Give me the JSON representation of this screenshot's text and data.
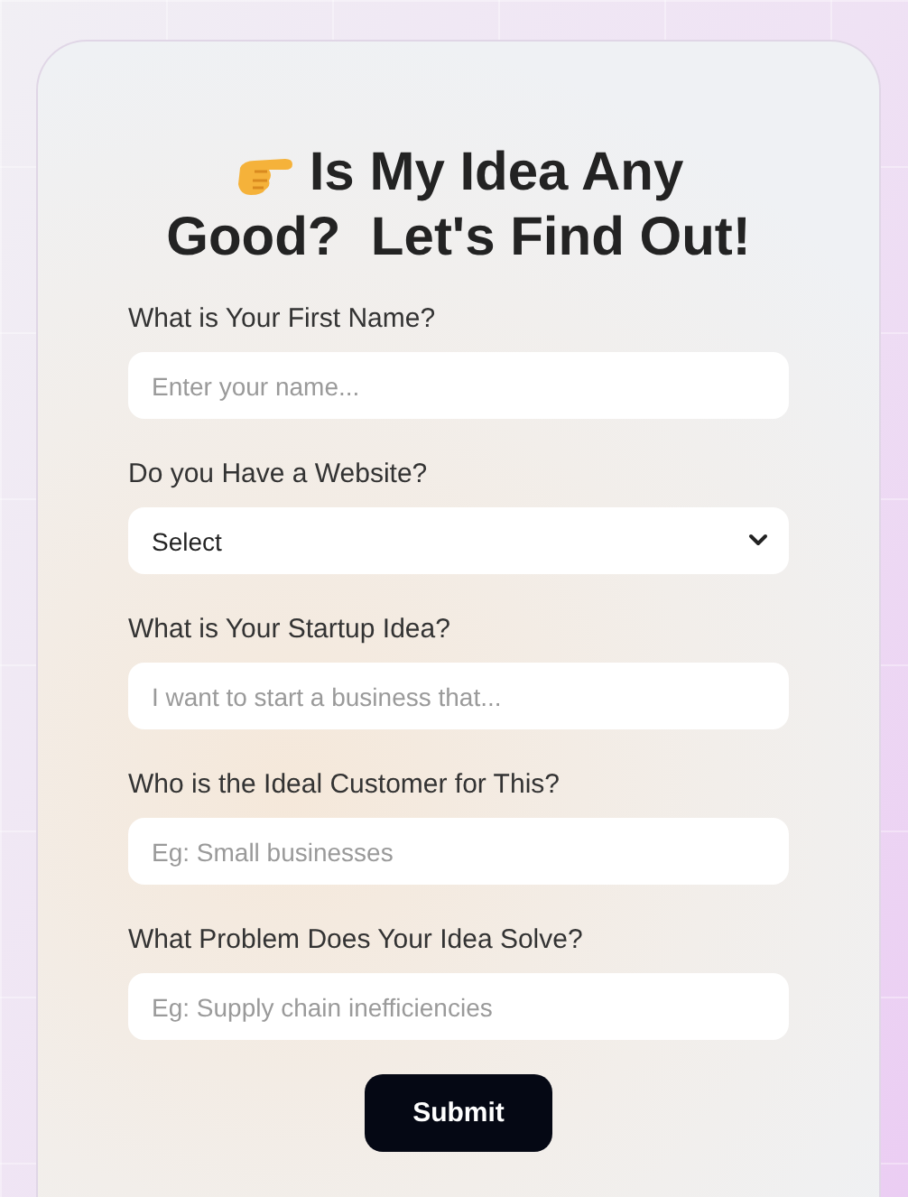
{
  "title_lines": [
    "Is My Idea Any",
    "Good?  Let's Find Out!"
  ],
  "fields": [
    {
      "kind": "text",
      "label": "What is Your First Name?",
      "placeholder": "Enter your name..."
    },
    {
      "kind": "select",
      "label": "Do you Have a Website?",
      "value": "Select"
    },
    {
      "kind": "text",
      "label": "What is Your Startup Idea?",
      "placeholder": "I want to start a business that..."
    },
    {
      "kind": "text",
      "label": "Who is the Ideal Customer for This?",
      "placeholder": "Eg: Small businesses"
    },
    {
      "kind": "text",
      "label": "What Problem Does Your Idea Solve?",
      "placeholder": "Eg: Supply chain inefficiencies"
    }
  ],
  "submit": "Submit"
}
